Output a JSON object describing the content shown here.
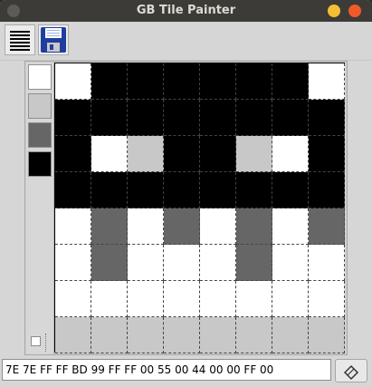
{
  "window": {
    "title": "GB Tile Painter"
  },
  "toolbar": {
    "items": [
      "menu-icon",
      "save-icon"
    ]
  },
  "palette": {
    "colors": [
      "#ffffff",
      "#c8c8c8",
      "#666666",
      "#000000"
    ],
    "selected_index": 3,
    "checkbox_checked": false
  },
  "tile": {
    "pixels": [
      [
        0,
        3,
        3,
        3,
        3,
        3,
        3,
        0
      ],
      [
        3,
        3,
        3,
        3,
        3,
        3,
        3,
        3
      ],
      [
        3,
        0,
        1,
        3,
        3,
        1,
        0,
        3
      ],
      [
        3,
        3,
        3,
        3,
        3,
        3,
        3,
        3
      ],
      [
        0,
        2,
        0,
        2,
        0,
        2,
        0,
        2
      ],
      [
        0,
        2,
        0,
        0,
        0,
        2,
        0,
        0
      ],
      [
        0,
        0,
        0,
        0,
        0,
        0,
        0,
        0
      ],
      [
        1,
        1,
        1,
        1,
        1,
        1,
        1,
        1
      ]
    ]
  },
  "status": {
    "hex": "7E 7E FF FF BD 99 FF FF 00 55 00 44 00 00 FF 00",
    "clear_icon": "eraser-icon"
  }
}
